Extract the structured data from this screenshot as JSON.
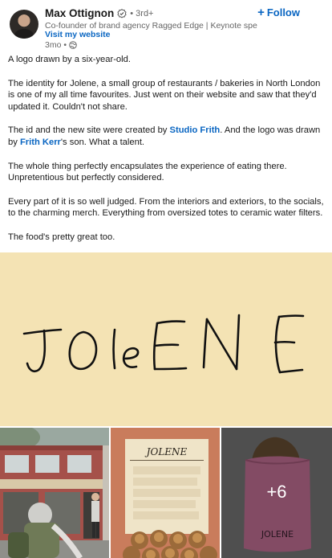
{
  "author": {
    "name": "Max Ottignon",
    "degree": "• 3rd+",
    "headline": "Co-founder of brand agency Ragged Edge | Keynote speaker an...",
    "website_label": "Visit my website",
    "time": "3mo •",
    "verified_icon": "verified-badge-icon",
    "visibility_icon": "globe-icon"
  },
  "follow_button": {
    "plus": "+",
    "label": "Follow"
  },
  "post": {
    "p1": "A logo drawn by a six-year-old.",
    "p2": "The identity for Jolene, a small group of restaurants / bakeries in North London is one of my all time favourites. Just went on their website and saw that they'd updated it. Couldn't not share.",
    "p3_a": "The id and the new site were created by ",
    "p3_link1": "Studio Frith",
    "p3_b": ". And the logo was drawn by ",
    "p3_link2": "Frith Kerr",
    "p3_c": "'s son. What a talent.",
    "p4": "The whole thing perfectly encapsulates the experience of eating there. Unpretentious but perfectly considered.",
    "p5": "Every part of it is so well judged. From the interiors and exteriors, to the socials, to the charming merch. Everything from oversized totes to ceramic water filters.",
    "p6": "The food's pretty great too."
  },
  "media": {
    "hero_logo": "JOLENE",
    "hero_bg": "#f4e3b4",
    "thumb_menu_logo": "JOLENE",
    "thumb_bag_logo": "JOLENE",
    "more_count": "+6"
  },
  "colors": {
    "link": "#0a66c2",
    "secondary_text": "#666666"
  }
}
